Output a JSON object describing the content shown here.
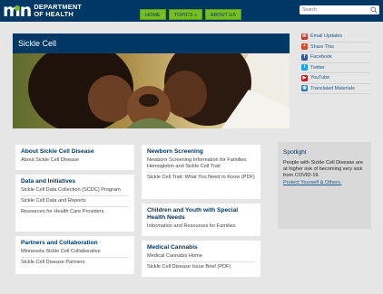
{
  "header": {
    "logo_mark": "mn",
    "logo_line1": "DEPARTMENT",
    "logo_line2": "OF HEALTH",
    "nav": [
      {
        "label": "HOME"
      },
      {
        "label": "TOPICS"
      },
      {
        "label": "ABOUT US"
      }
    ],
    "search_placeholder": "Search"
  },
  "page": {
    "title": "Sickle Cell"
  },
  "social": [
    {
      "label": "Email Updates",
      "icon": "envelope-icon",
      "color": "#c0392b"
    },
    {
      "label": "Share This",
      "icon": "share-icon",
      "color": "#d04a2a"
    },
    {
      "label": "Facebook",
      "icon": "facebook-icon",
      "color": "#3b5998"
    },
    {
      "label": "Twitter",
      "icon": "twitter-icon",
      "color": "#1da1f2"
    },
    {
      "label": "YouTube",
      "icon": "youtube-icon",
      "color": "#cc181e"
    },
    {
      "label": "Translated Materials",
      "icon": "globe-icon",
      "color": "#2b7bb9"
    }
  ],
  "sections": {
    "about": {
      "heading": "About Sickle Cell Disease",
      "links": [
        "About Sickle Cell Disease"
      ]
    },
    "data": {
      "heading": "Data and Initiatives",
      "links": [
        "Sickle Cell Data Collection (SCDC) Program",
        "Sickle Cell Data and Reports",
        "Resources for Health Care Providers"
      ]
    },
    "partners": {
      "heading": "Partners and Collaboration",
      "links": [
        "Minnesota Sickle Cell Collaborative",
        "Sickle Cell Disease Partners"
      ]
    },
    "newborn": {
      "heading": "Newborn Screening",
      "links": [
        "Newborn Screening Information for Families: Hemoglobin and Sickle Cell Trait",
        "Sickle Cell Trait: What You Need to Know (PDF)"
      ]
    },
    "children": {
      "heading": "Children and Youth with Special Health Needs",
      "links": [
        "Information and Resources for Families"
      ]
    },
    "cannabis": {
      "heading": "Medical Cannabis",
      "links": [
        "Medical Cannabis Home",
        "Sickle Cell Disease Issue Brief (PDF)"
      ]
    }
  },
  "spotlight": {
    "heading": "Spotlight",
    "body": "People with Sickle Cell Disease are at higher risk of becoming very sick from COVID-19.",
    "cta": "Protect Yourself & Others."
  },
  "colors": {
    "brand_navy": "#003865",
    "brand_green": "#78be20",
    "link_blue": "#1d5690"
  }
}
